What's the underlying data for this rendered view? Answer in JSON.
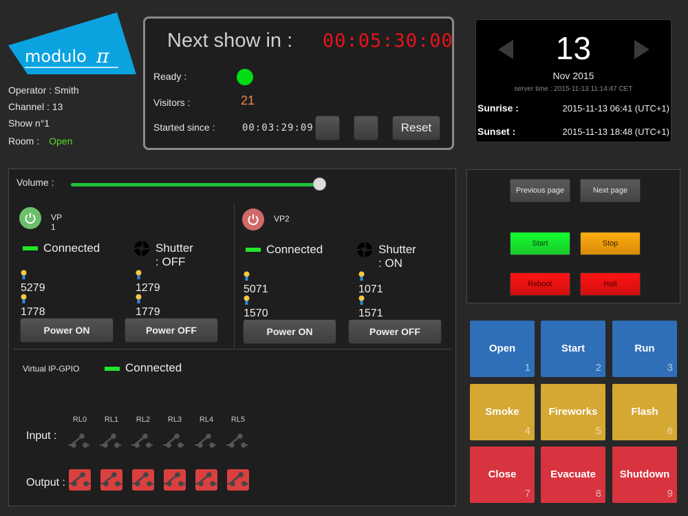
{
  "brand": {
    "name": "modulo",
    "symbol": "π",
    "color": "#0aa3e0"
  },
  "info": {
    "operator": "Operator : Smith",
    "channel": "Channel : 13",
    "show": "Show n°1",
    "room_label": "Room :",
    "room_status": "Open"
  },
  "show": {
    "next_label": "Next show in :",
    "next_time": "00:05:30:00",
    "ready_label": "Ready :",
    "ready_state": "ready",
    "visitors_label": "Visitors :",
    "visitors": "21",
    "started_label": "Started since :",
    "started_time": "00:03:29:09",
    "buttons": {
      "blank1": "",
      "blank2": "",
      "reset": "Reset"
    }
  },
  "date": {
    "day": "13",
    "month_year": "Nov 2015",
    "server_time": "server time : 2015-11-13 11:14:47 CET",
    "sunrise_label": "Sunrise :",
    "sunrise": "2015-11-13 06:41 (UTC+1)",
    "sunset_label": "Sunset :",
    "sunset": "2015-11-13 18:48 (UTC+1)",
    "prev_icon": "triangle-left-icon",
    "next_icon": "triangle-right-icon"
  },
  "volume": {
    "label": "Volume :",
    "value_percent": 100
  },
  "projectors": [
    {
      "name": "VP 1",
      "power_state": "on",
      "power_color": "#6bbf6b",
      "connection": "Connected",
      "shutter": "Shutter : OFF",
      "lamps": [
        "5279",
        "1279",
        "1778",
        "1779"
      ],
      "power_on": "Power ON",
      "power_off": "Power OFF"
    },
    {
      "name": "VP2",
      "power_state": "off",
      "power_color": "#d06a6a",
      "connection": "Connected",
      "shutter": "Shutter : ON",
      "lamps": [
        "5071",
        "1071",
        "1570",
        "1571"
      ],
      "power_on": "Power ON",
      "power_off": "Power OFF"
    }
  ],
  "gpio": {
    "label": "Virtual IP-GPIO",
    "connection": "Connected",
    "relays": [
      "RL0",
      "RL1",
      "RL2",
      "RL3",
      "RL4",
      "RL5"
    ],
    "input_label": "Input :",
    "output_label": "Output :",
    "inputs_active": [
      false,
      false,
      false,
      false,
      false,
      false
    ],
    "outputs_active": [
      true,
      true,
      true,
      true,
      true,
      true
    ]
  },
  "controls": {
    "previous_page": "Previous page",
    "next_page": "Next page",
    "start": "Start",
    "stop": "Stop",
    "reboot": "Reboot",
    "halt": "Halt"
  },
  "scenes": [
    {
      "label": "Open",
      "num": "1",
      "color": "blue"
    },
    {
      "label": "Start",
      "num": "2",
      "color": "blue"
    },
    {
      "label": "Run",
      "num": "3",
      "color": "blue"
    },
    {
      "label": "Smoke",
      "num": "4",
      "color": "yellow"
    },
    {
      "label": "Fireworks",
      "num": "5",
      "color": "yellow"
    },
    {
      "label": "Flash",
      "num": "6",
      "color": "yellow"
    },
    {
      "label": "Close",
      "num": "7",
      "color": "red"
    },
    {
      "label": "Evacuate",
      "num": "8",
      "color": "red"
    },
    {
      "label": "Shutdown",
      "num": "9",
      "color": "red"
    }
  ]
}
